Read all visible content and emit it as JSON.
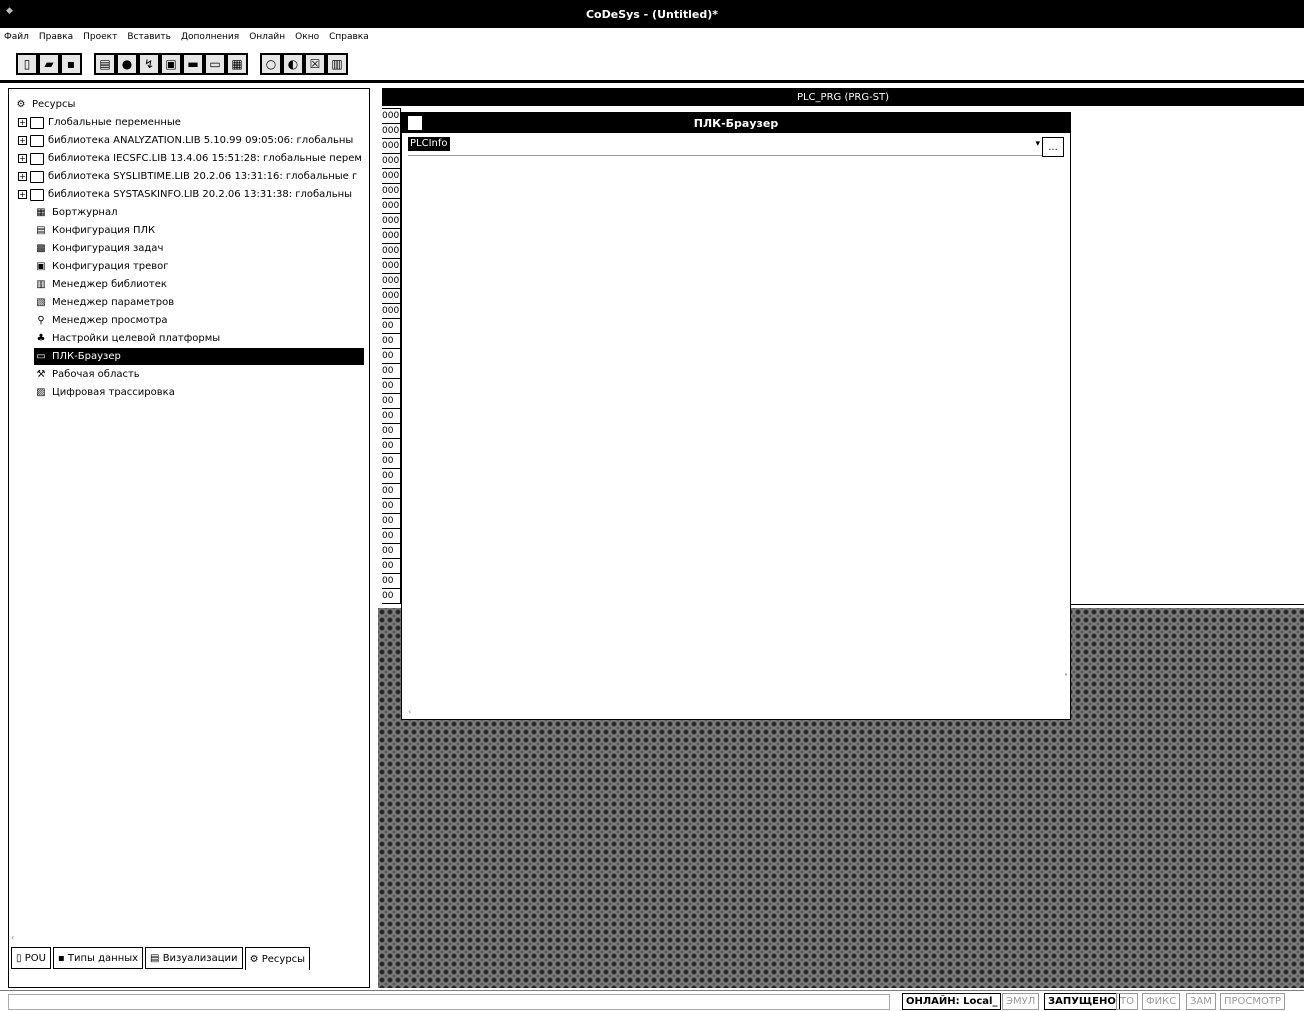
{
  "app": {
    "title": "CoDeSys - (Untitled)*"
  },
  "menu": [
    "Файл",
    "Правка",
    "Проект",
    "Вставить",
    "Дополнения",
    "Онлайн",
    "Окно",
    "Справка"
  ],
  "toolbar": {
    "icons": [
      "new-icon",
      "open-icon",
      "save-icon",
      "build-icon",
      "compile-icon",
      "login-icon",
      "logout-icon",
      "run-icon",
      "stop-icon",
      "print-icon",
      "start-icon",
      "step-icon",
      "breakpoint-icon",
      "trace-icon"
    ]
  },
  "tree": {
    "root": "Ресурсы",
    "items": [
      {
        "label": "Глобальные переменные",
        "type": "folder"
      },
      {
        "label": "библиотека ANALYZATION.LIB 5.10.99 09:05:06: глобальны",
        "type": "folder"
      },
      {
        "label": "библиотека IECSFC.LIB 13.4.06 15:51:28: глобальные перем",
        "type": "folder"
      },
      {
        "label": "библиотека SYSLIBTIME.LIB 20.2.06 13:31:16: глобальные г",
        "type": "folder"
      },
      {
        "label": "библиотека SYSTASKINFO.LIB 20.2.06 13:31:38: глобальны",
        "type": "folder"
      },
      {
        "label": "Бортжурнал",
        "type": "leaf"
      },
      {
        "label": "Конфигурация ПЛК",
        "type": "leaf"
      },
      {
        "label": "Конфигурация задач",
        "type": "leaf"
      },
      {
        "label": "Конфигурация тревог",
        "type": "leaf"
      },
      {
        "label": "Менеджер библиотек",
        "type": "leaf"
      },
      {
        "label": "Менеджер параметров",
        "type": "leaf"
      },
      {
        "label": "Менеджер просмотра",
        "type": "leaf"
      },
      {
        "label": "Настройки целевой платформы",
        "type": "leaf"
      },
      {
        "label": "ПЛК-Браузер",
        "type": "leaf",
        "selected": true
      },
      {
        "label": "Рабочая область",
        "type": "leaf"
      },
      {
        "label": "Цифровая трассировка",
        "type": "leaf"
      }
    ]
  },
  "tabs": [
    {
      "label": "POU"
    },
    {
      "label": "Типы данных"
    },
    {
      "label": "Визуализации"
    },
    {
      "label": "Ресурсы",
      "active": true
    }
  ],
  "editor": {
    "title": "PLC_PRG (PRG-ST)",
    "line_numbers": [
      "000",
      "000",
      "000",
      "000",
      "000",
      "000",
      "000",
      "000",
      "000",
      "000",
      "000",
      "000",
      "000",
      "000",
      "00",
      "00",
      "00",
      "00",
      "00",
      "00",
      "00",
      "00",
      "00",
      "00",
      "00",
      "00",
      "00",
      "00",
      "00",
      "00",
      "00",
      "00",
      "00"
    ]
  },
  "browser": {
    "title": "ПЛК-Браузер",
    "command": "PLCInfo",
    "more_label": "..."
  },
  "status": {
    "online": "ОНЛАЙН: Local_",
    "emul": "ЭМУЛ",
    "running": "ЗАПУЩЕНО",
    "to": "ТО",
    "fix": "ФИКС",
    "zam": "ЗАМ",
    "view": "ПРОСМОТР"
  }
}
